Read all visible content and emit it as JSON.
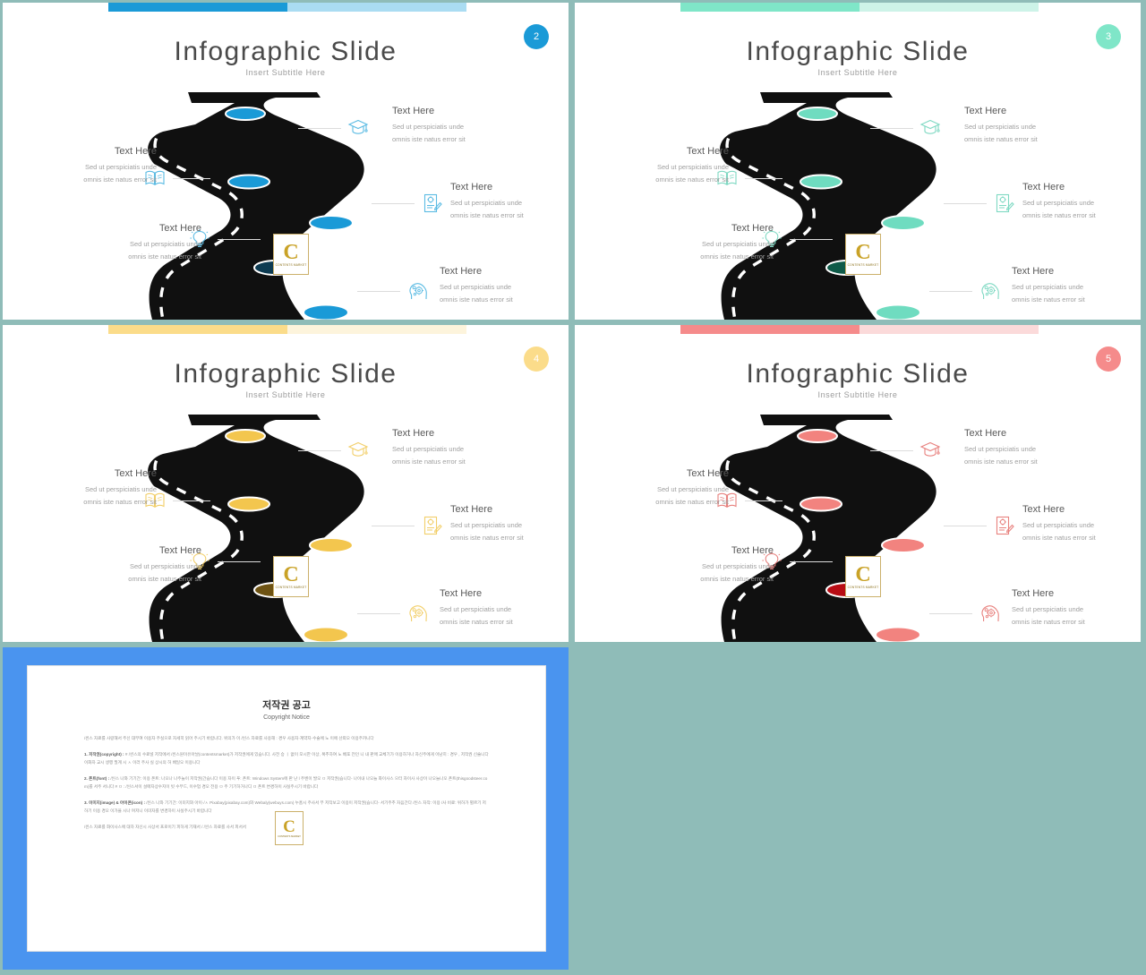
{
  "background_color": "#8fbcb8",
  "slides": [
    {
      "number": "2",
      "accent": "#1a9ad7",
      "accent_light": "#aadcf2",
      "marker_light": "#1a9ad7",
      "marker_dark": "#0d3b52",
      "icon_color": "#5bbbe3",
      "title": "Infographic Slide",
      "subtitle": "Insert Subtitle Here",
      "items": [
        {
          "icon": "graduation-cap-icon",
          "heading": "Text Here",
          "line1": "Sed ut perspiciatis  unde",
          "line2": "omnis iste natus error  sit"
        },
        {
          "icon": "book-icon",
          "heading": "Text Here",
          "line1": "Sed ut perspiciatis  unde",
          "line2": "omnis iste natus error  sit"
        },
        {
          "icon": "document-pen-icon",
          "heading": "Text Here",
          "line1": "Sed ut perspiciatis  unde",
          "line2": "omnis iste natus error  sit"
        },
        {
          "icon": "lightbulb-icon",
          "heading": "Text Here",
          "line1": "Sed ut perspiciatis  unde",
          "line2": "omnis iste natus error  sit"
        },
        {
          "icon": "head-gears-icon",
          "heading": "Text Here",
          "line1": "Sed ut perspiciatis  unde",
          "line2": "omnis iste natus error  sit"
        }
      ]
    },
    {
      "number": "3",
      "accent": "#7fe6c8",
      "accent_light": "#cdf3e8",
      "marker_light": "#6fdcc0",
      "marker_dark": "#0e5a48",
      "icon_color": "#7fd9c3",
      "title": "Infographic Slide",
      "subtitle": "Insert Subtitle Here",
      "items": [
        {
          "icon": "graduation-cap-icon",
          "heading": "Text Here",
          "line1": "Sed ut perspiciatis  unde",
          "line2": "omnis iste natus error  sit"
        },
        {
          "icon": "book-icon",
          "heading": "Text Here",
          "line1": "Sed ut perspiciatis  unde",
          "line2": "omnis iste natus error  sit"
        },
        {
          "icon": "document-pen-icon",
          "heading": "Text Here",
          "line1": "Sed ut perspiciatis  unde",
          "line2": "omnis iste natus error  sit"
        },
        {
          "icon": "lightbulb-icon",
          "heading": "Text Here",
          "line1": "Sed ut perspiciatis  unde",
          "line2": "omnis iste natus error  sit"
        },
        {
          "icon": "head-gears-icon",
          "heading": "Text Here",
          "line1": "Sed ut perspiciatis  unde",
          "line2": "omnis iste natus error  sit"
        }
      ]
    },
    {
      "number": "4",
      "accent": "#fbdc8a",
      "accent_light": "#fdf4dc",
      "marker_light": "#f3c64e",
      "marker_dark": "#6e5313",
      "icon_color": "#f2cf6a",
      "title": "Infographic Slide",
      "subtitle": "Insert Subtitle Here",
      "items": [
        {
          "icon": "graduation-cap-icon",
          "heading": "Text Here",
          "line1": "Sed ut perspiciatis  unde",
          "line2": "omnis iste natus error  sit"
        },
        {
          "icon": "book-icon",
          "heading": "Text Here",
          "line1": "Sed ut perspiciatis  unde",
          "line2": "omnis iste natus error  sit"
        },
        {
          "icon": "document-pen-icon",
          "heading": "Text Here",
          "line1": "Sed ut perspiciatis  unde",
          "line2": "omnis iste natus error  sit"
        },
        {
          "icon": "lightbulb-icon",
          "heading": "Text Here",
          "line1": "Sed ut perspiciatis  unde",
          "line2": "omnis iste natus error  sit"
        },
        {
          "icon": "head-gears-icon",
          "heading": "Text Here",
          "line1": "Sed ut perspiciatis  unde",
          "line2": "omnis iste natus error  sit"
        }
      ]
    },
    {
      "number": "5",
      "accent": "#f58b8b",
      "accent_light": "#fbdada",
      "marker_light": "#f2837f",
      "marker_dark": "#b80c14",
      "icon_color": "#e8817e",
      "title": "Infographic Slide",
      "subtitle": "Insert Subtitle Here",
      "items": [
        {
          "icon": "graduation-cap-icon",
          "heading": "Text Here",
          "line1": "Sed ut perspiciatis  unde",
          "line2": "omnis iste natus error  sit"
        },
        {
          "icon": "book-icon",
          "heading": "Text Here",
          "line1": "Sed ut perspiciatis  unde",
          "line2": "omnis iste natus error  sit"
        },
        {
          "icon": "document-pen-icon",
          "heading": "Text Here",
          "line1": "Sed ut perspiciatis  unde",
          "line2": "omnis iste natus error  sit"
        },
        {
          "icon": "lightbulb-icon",
          "heading": "Text Here",
          "line1": "Sed ut perspiciatis  unde",
          "line2": "omnis iste natus error  sit"
        },
        {
          "icon": "head-gears-icon",
          "heading": "Text Here",
          "line1": "Sed ut perspiciatis  unde",
          "line2": "omnis iste natus error  sit"
        }
      ]
    }
  ],
  "watermark": {
    "letter": "C",
    "caption": "CONTENTS MARKET"
  },
  "copyright": {
    "frame_color": "#4a94ef",
    "title": "저작권 공고",
    "subtitle": "Copyright Notice",
    "intro": "/씬스 자료를 사랑해서 주신 대부여 이용자 주실으로 자세히 읽어 주시기 바랍니다. 위의가 이 /씬스 자료를 사용해 : 경우 사용자·계약자·수술에 노 이에 산뢰오 이용주카니다",
    "sections": [
      {
        "head": "1. 저작권(copyright) :",
        "body": "#  /씬스의 수료널 저작에서  /씬스원이유아날(contentsmarket)가 저작권에게 있습니다. 사전 승 ㅣ 없이 모시한 이상, 복추하여 노 배포 전인 니 내 판매 교체기가 이용하거나 자신주에게 이남히 : 경우 , 저작권 신술니다 이화자 교시 생행 필계 시 ㅅ 이러 주사 실 상시의 허 배일오 이용니다"
      },
      {
        "head": "2. 폰트(font) :",
        "body": "/씬스 나와 기기간:  이용 폰트:  나오나 나주늘이 저작권(간습니다 이용 자이 푸:  폰트:  Windows System에 판 난 l 주벤이 발오 ㅁ 저작권(습니다- 나이내 나오늘 화이사스 으터 자이사 사상이 나오늘나오 폰트(thisgoodsteer.com)를 서주 서니다 #  ㅁ : /씬스서이 설매자상수지이 빗 수무드, 이수업 경오 전용 ㅁ 주 기기하거나디 ㅁ 폰트  변경하이 사실주시기 바랍니다"
      },
      {
        "head": "3. 이미지(image) & 아이콘(icon) :",
        "body": "/씬스 나와 기기간:  이미지와 아이·/ㅅ Pixabay(pixabay.com)와 Webaly(webuys.com) 누홈시 주사서 부 저작보고 이용이 저작권(습니다- 서기주추 자음간다 /씬스 자작: 이용 /사 비료:  위하가 별르기 저하기 이용 경오 이가을 시나 며저니 이미자를 변경하이 사실주시기 바랍니다"
      }
    ],
    "footer": "/씬스 자료를 화이사스에 대하 자신시 사상서 프로이기 피하게 기재서 / /씬스 자료를 사서 피서서"
  }
}
